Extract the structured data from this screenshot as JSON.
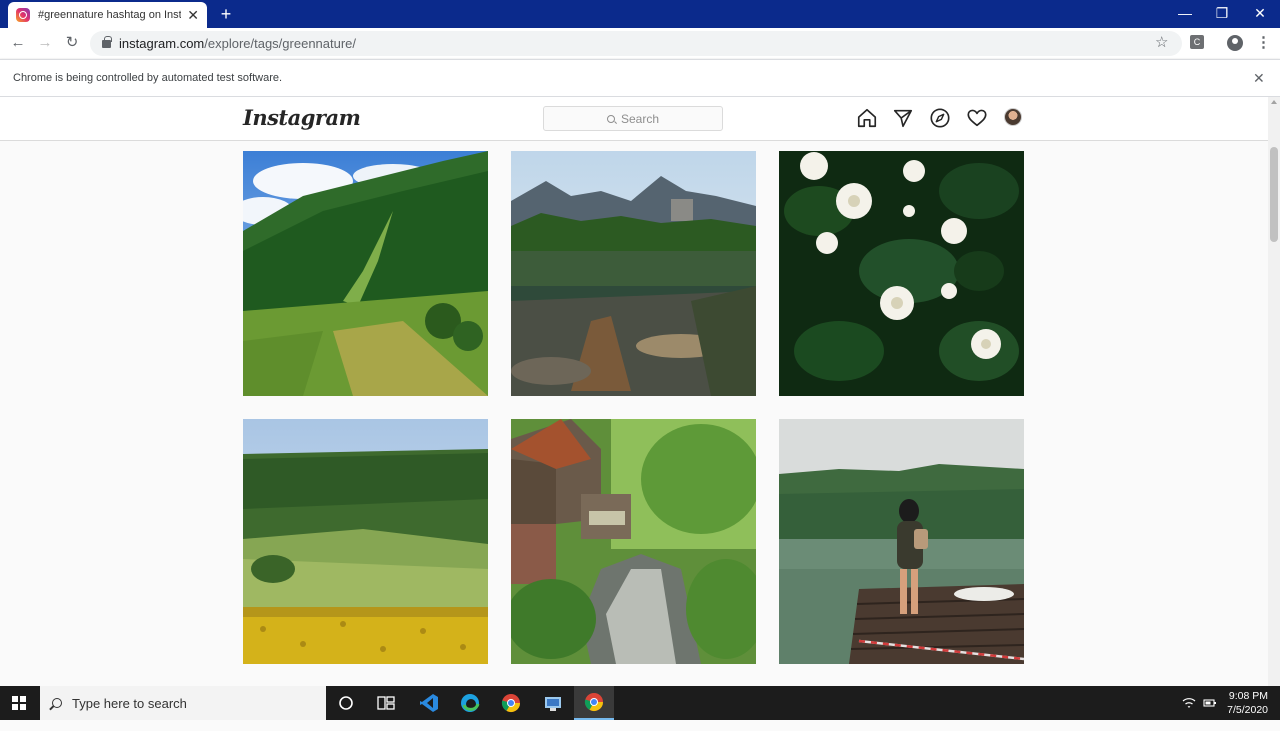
{
  "browser": {
    "tab_title": "#greennature hashtag on Instagram",
    "tab_close": "✕",
    "new_tab": "+",
    "url_host": "instagram.com",
    "url_path": "/explore/tags/greennature/",
    "extension_letter": "C",
    "window_min": "—",
    "window_restore": "❐",
    "window_close": "✕",
    "back": "←",
    "forward": "→",
    "reload": "↻",
    "bookmark": "☆",
    "menu": "⋮"
  },
  "infobar": {
    "message": "Chrome is being controlled by automated test software.",
    "close": "✕"
  },
  "instagram": {
    "logo": "Instagram",
    "search_placeholder": "Search",
    "nav_icons": [
      "home-icon",
      "direct-icon",
      "explore-icon",
      "activity-icon",
      "avatar"
    ],
    "posts": [
      {
        "name": "post-mountain-valley"
      },
      {
        "name": "post-mountain-lake"
      },
      {
        "name": "post-white-flowers"
      },
      {
        "name": "post-sunflower-field"
      },
      {
        "name": "post-mill-stream"
      },
      {
        "name": "post-lake-pier"
      }
    ]
  },
  "taskbar": {
    "search_placeholder": "Type here to search",
    "time": "9:08 PM",
    "date": "7/5/2020",
    "apps": [
      "cortana-icon",
      "task-view-icon",
      "vscode-icon",
      "edge-icon",
      "chrome-icon",
      "network-app-icon",
      "chrome-active-icon"
    ]
  },
  "colors": {
    "titlebar": "#0b2a8c",
    "taskbar": "#1c1c1c",
    "ig_border": "#dbdbdb"
  }
}
